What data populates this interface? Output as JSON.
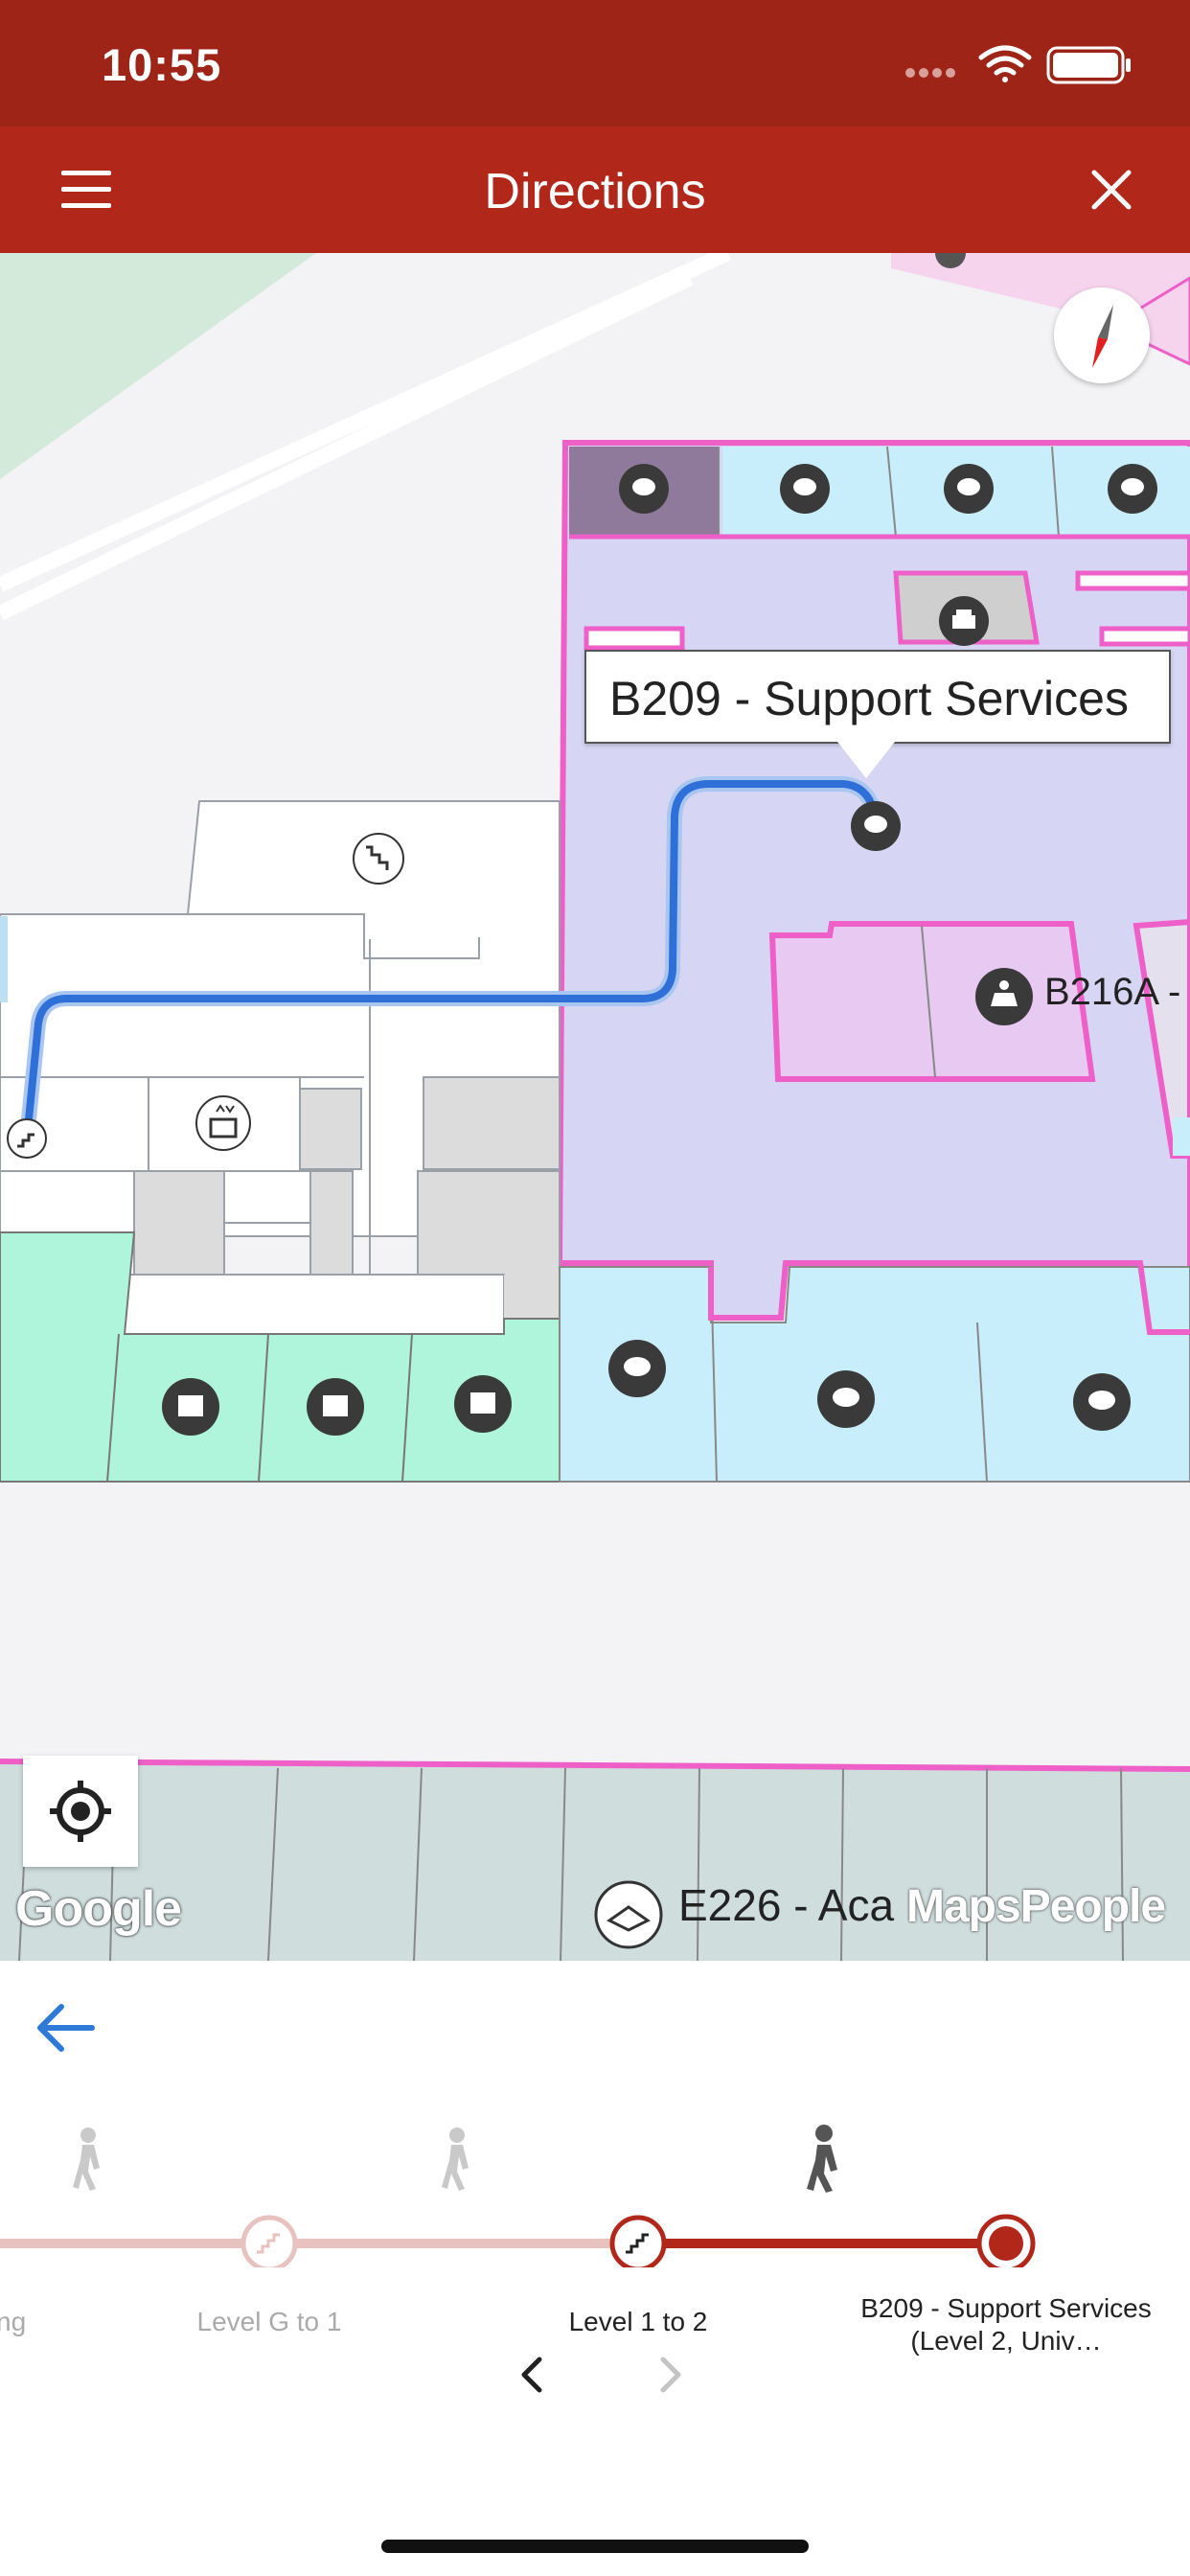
{
  "status_bar": {
    "time": "10:55",
    "icons": [
      "signal-icon",
      "wifi-icon",
      "battery-icon"
    ]
  },
  "app_bar": {
    "title": "Directions",
    "menu_icon": "hamburger-menu-icon",
    "close_icon": "close-icon",
    "background_color": "#b1281b"
  },
  "map": {
    "selected_room_callout": "B209 - Support Services",
    "room_labels": {
      "b216a": "B216A -",
      "e226": "E226 - Aca"
    },
    "attribution_google": "Google",
    "attribution_mapspeople": "MapsPeople",
    "route_color": "#2f6fd8",
    "room_outline_color": "#ee5fc8",
    "compass_icon": "compass-icon",
    "locate_icon": "my-location-icon"
  },
  "directions_panel": {
    "back_icon": "arrow-left-icon",
    "steps": [
      {
        "label": "ng",
        "state": "past"
      },
      {
        "label": "Level G to 1",
        "state": "past"
      },
      {
        "label": "Level 1 to 2",
        "state": "current"
      },
      {
        "label": "B209 - Support Services (Level 2, Univ…",
        "state": "destination"
      }
    ],
    "accent_color": "#b1281b",
    "pager_prev_icon": "chevron-left-icon",
    "pager_next_icon": "chevron-right-icon"
  }
}
